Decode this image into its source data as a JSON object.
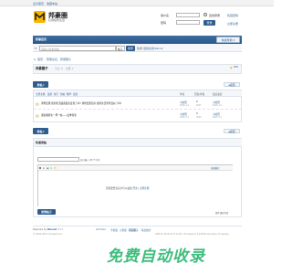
{
  "topbar": {
    "set_home": "设为首页",
    "bookmark": "收藏本站"
  },
  "logo": {
    "title": "邦豪圈",
    "subtitle": "红绿装修生活"
  },
  "login": {
    "username_label": "用户名",
    "username_option": "用户名",
    "password_label": "密码",
    "auto_login": "自动登录",
    "forgot_password": "找回密码",
    "login_button": "登录",
    "register": "立即注册"
  },
  "nav": {
    "home": "邦豪首页",
    "quick_nav": "快捷导航"
  },
  "search": {
    "placeholder": "请输入搜索内容",
    "type": "帖子",
    "button": "搜索",
    "hot_label": "热搜:",
    "hot_items": [
      "活动",
      "交友",
      "discuz"
    ]
  },
  "breadcrumb": {
    "home": "首页",
    "forum": "邦豪论坛",
    "board": "邦豪圈子"
  },
  "board": {
    "title": "邦豪圈子",
    "stats_today": "今日: 0",
    "stats_topics": "主题: 2",
    "rss": "RSS"
  },
  "post_button": "发帖",
  "back_button": "返回",
  "list_filters": [
    "全部主题",
    "最新",
    "热门",
    "热帖",
    "精华",
    "更多"
  ],
  "list_columns": {
    "author": "作者",
    "replies": "回复/查看",
    "last_post": "最后发表"
  },
  "topics": [
    {
      "title": "调查结果:您的生活品质发生变化了吗? 调查结果显示,您的生活条件变好了吗?",
      "author": "小欧阳",
      "date": "2015-1-1",
      "replies": "0",
      "views": "2017",
      "last_author": "小欧阳",
      "last_date": "2015-1-1"
    },
    {
      "title": "朋友圈养生一周一帖——四季养生",
      "author": "小欧阳",
      "date": "2015-1-1",
      "replies": "0",
      "views": "2015",
      "last_author": "小欧阳",
      "last_date": "2015-1-1"
    }
  ],
  "quick_post": {
    "title": "快速发帖",
    "editor_hint": "还可输入 80 个字符",
    "advanced": "高级模式",
    "login_hint": "您需要登录后才可以发帖",
    "login_link": "登录",
    "register_link": "立即注册",
    "submit": "发表帖子",
    "notify": "邮件通知作者"
  },
  "footer": {
    "powered": "Powered by",
    "discuz": "Discuz!",
    "version": "X3.2",
    "copyright": "© 2001-2013 Comsenz Inc.",
    "links": [
      "Archiver",
      "手机版",
      "小黑屋",
      "邦豪圈子",
      "站长统计"
    ],
    "time_info": "GMT+8, 2015-10-27 12:00 , Processed in 0.047991 second(s), 15 queries ."
  },
  "watermark": "免费自动收录",
  "colors": {
    "accent": "#2f5d92",
    "brand_yellow": "#f7b500",
    "watermark_green": "#2eb872"
  }
}
